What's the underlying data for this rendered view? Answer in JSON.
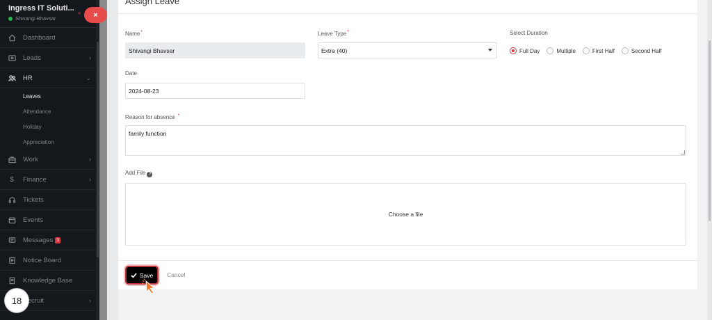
{
  "sidebar": {
    "company": "Ingress IT Soluti...",
    "user": "Shivangi Bhavsar",
    "items": [
      {
        "label": "Dashboard",
        "icon": "dashboard-icon"
      },
      {
        "label": "Leads",
        "icon": "leads-icon"
      },
      {
        "label": "HR",
        "icon": "hr-icon"
      },
      {
        "label": "Work",
        "icon": "briefcase-icon"
      },
      {
        "label": "Finance",
        "icon": "dollar-icon"
      },
      {
        "label": "Tickets",
        "icon": "headset-icon"
      },
      {
        "label": "Events",
        "icon": "calendar-icon"
      },
      {
        "label": "Messages",
        "icon": "message-icon",
        "badge": "3"
      },
      {
        "label": "Notice Board",
        "icon": "notice-icon"
      },
      {
        "label": "Knowledge Base",
        "icon": "book-icon"
      },
      {
        "label": "Recruit",
        "icon": "recruit-icon"
      }
    ],
    "hr_subitems": [
      "Leaves",
      "Attendance",
      "Holiday",
      "Appreciation"
    ]
  },
  "step_number": "18",
  "close_label": "×",
  "form": {
    "title": "Assign Leave",
    "name_label": "Name",
    "name_value": "Shivangi Bhavsar",
    "leave_type_label": "Leave Type",
    "leave_type_value": "Extra (40)",
    "duration_label": "Select Duration",
    "duration_options": [
      "Full Day",
      "Multiple",
      "First Half",
      "Second Half"
    ],
    "duration_selected": "Full Day",
    "date_label": "Date",
    "date_value": "2024-08-23",
    "reason_label": "Reason for absence",
    "reason_value": "family function",
    "file_label": "Add File",
    "file_placeholder": "Choose a file",
    "save_label": "Save",
    "cancel_label": "Cancel"
  },
  "colors": {
    "accent": "#d9343b",
    "sidebar_bg": "#14171b",
    "close_button": "#e74c4c"
  }
}
